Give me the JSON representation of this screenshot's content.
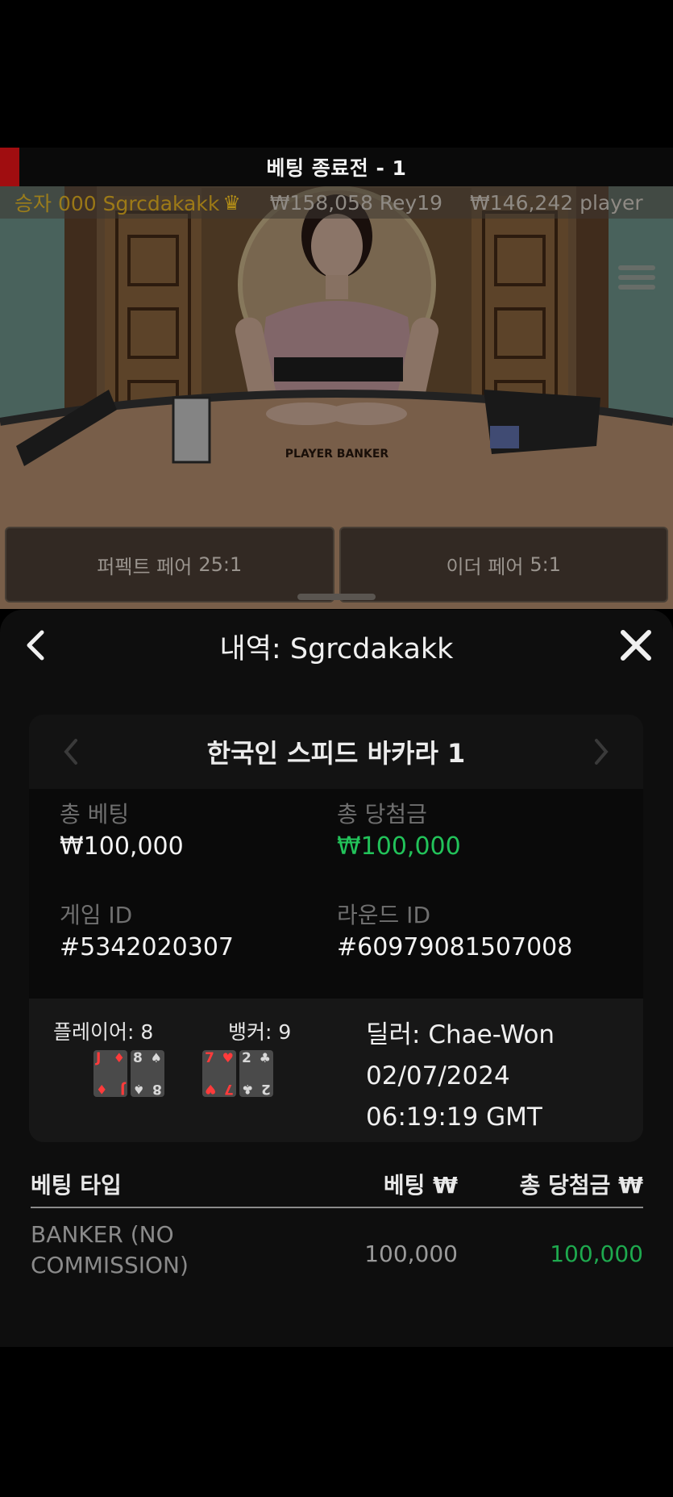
{
  "status": {
    "text": "베팅 종료전 - 1"
  },
  "ticker": {
    "leader": "승자 000 Sgrcdakakk",
    "entries": [
      "₩158,058 Rey19",
      "₩146,242 player"
    ]
  },
  "side_bets": [
    {
      "label": "퍼펙트 페어",
      "ratio": "25:1"
    },
    {
      "label": "이더 페어",
      "ratio": "5:1"
    }
  ],
  "table_sign": "PLAYER BANKER",
  "history": {
    "title": "내역: Sgrcdakakk",
    "game_name": "한국인 스피드 바카라 1",
    "total_bet_label": "총 베팅",
    "total_bet_value": "₩100,000",
    "total_win_label": "총 당첨금",
    "total_win_value": "₩100,000",
    "game_id_label": "게임 ID",
    "game_id_value": "#5342020307",
    "round_id_label": "라운드 ID",
    "round_id_value": "#60979081507008",
    "player_label": "플레이어: 8",
    "banker_label": "뱅커: 9",
    "player_cards": [
      {
        "rank": "J",
        "suit": "♦",
        "color": "red"
      },
      {
        "rank": "8",
        "suit": "♠",
        "color": "dark"
      }
    ],
    "banker_cards": [
      {
        "rank": "7",
        "suit": "♥",
        "color": "red"
      },
      {
        "rank": "2",
        "suit": "♣",
        "color": "dark"
      }
    ],
    "dealer": "딜러: Chae-Won",
    "date": "02/07/2024",
    "time": "06:19:19 GMT",
    "columns": {
      "type": "베팅 타입",
      "bet": "베팅 ₩",
      "win": "총 당첨금 ₩"
    },
    "rows": [
      {
        "type": "BANKER (NO COMMISSION)",
        "bet": "100,000",
        "win": "100,000"
      }
    ]
  },
  "colors": {
    "accent_green": "#22c35a",
    "status_red": "#a00d10",
    "ticker_gold": "#b28a12"
  }
}
